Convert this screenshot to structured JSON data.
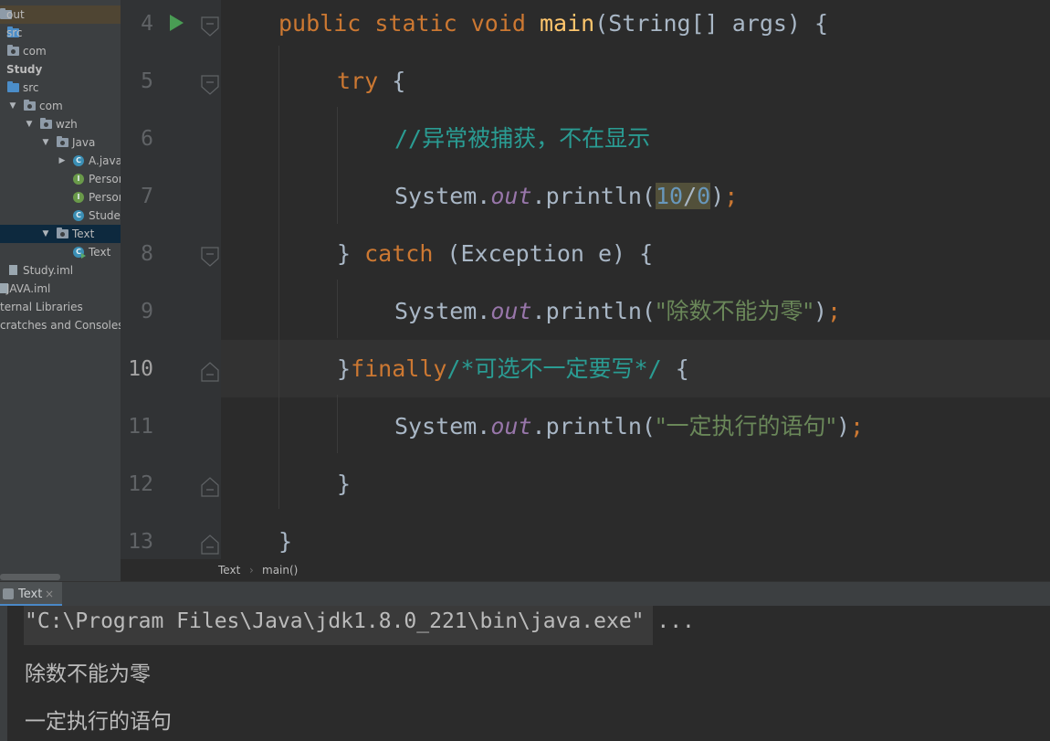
{
  "project_tree": {
    "items": [
      {
        "label": "out",
        "icon": "folder-icon",
        "kind": "folder-out",
        "arrow": "",
        "highlight": "orange"
      },
      {
        "label": "src",
        "icon": "source-folder-icon",
        "kind": "folder-src",
        "arrow": ""
      },
      {
        "label": "com",
        "icon": "package-icon",
        "kind": "package",
        "arrow": ""
      },
      {
        "label": "Study",
        "icon": "",
        "kind": "module",
        "arrow": "",
        "bold": true
      },
      {
        "label": "src",
        "icon": "source-folder-icon",
        "kind": "folder-src",
        "arrow": ""
      },
      {
        "label": "com",
        "icon": "package-icon",
        "kind": "package",
        "arrow": "expanded"
      },
      {
        "label": "wzh",
        "icon": "package-icon",
        "kind": "package",
        "arrow": "expanded"
      },
      {
        "label": "Java",
        "icon": "package-icon",
        "kind": "package",
        "arrow": "expanded"
      },
      {
        "label": "A.java",
        "icon": "class-icon",
        "kind": "class",
        "arrow": "collapsed"
      },
      {
        "label": "Person",
        "icon": "interface-icon",
        "kind": "interface",
        "arrow": ""
      },
      {
        "label": "Person",
        "icon": "interface-icon",
        "kind": "interface",
        "arrow": ""
      },
      {
        "label": "Studer",
        "icon": "class-icon",
        "kind": "class",
        "arrow": ""
      },
      {
        "label": "Text",
        "icon": "package-icon",
        "kind": "package",
        "arrow": "expanded",
        "highlight": "blue"
      },
      {
        "label": "Text",
        "icon": "runnable-class-icon",
        "kind": "runclass",
        "arrow": ""
      },
      {
        "label": "Study.iml",
        "icon": "iml-file-icon",
        "kind": "iml",
        "arrow": ""
      },
      {
        "label": "JAVA.iml",
        "icon": "iml-file-icon",
        "kind": "iml",
        "arrow": ""
      },
      {
        "label": "ternal Libraries",
        "icon": "",
        "kind": "plain",
        "arrow": ""
      },
      {
        "label": "cratches and Consoles",
        "icon": "",
        "kind": "plain",
        "arrow": ""
      }
    ]
  },
  "gutter": {
    "line_numbers": [
      "4",
      "5",
      "6",
      "7",
      "8",
      "9",
      "10",
      "11",
      "12",
      "13"
    ],
    "current_line": "10"
  },
  "code": {
    "l4": {
      "t1": "public static void ",
      "t2": "main",
      "t3": "(String[] args) {"
    },
    "l5": {
      "t1": "try",
      "t2": " {"
    },
    "l6": {
      "t1": "//",
      "t2": "异常被捕获，不在显示"
    },
    "l7": {
      "t1": "System.",
      "t2": "out",
      "t3": ".println(",
      "t4": "10",
      "t5": "/",
      "t6": "0",
      "t7": ")",
      "t8": ";"
    },
    "l8": {
      "t1": "} ",
      "t2": "catch",
      "t3": " (Exception e) {"
    },
    "l9": {
      "t1": "System.",
      "t2": "out",
      "t3": ".println(",
      "t4": "\"除数不能为零\"",
      "t5": ")",
      "t6": ";"
    },
    "l10": {
      "t1": "}",
      "t2": "finally",
      "t3": "/*",
      "t4": "可选不一定要写",
      "t5": "*/",
      "t6": " {"
    },
    "l11": {
      "t1": "System.",
      "t2": "out",
      "t3": ".println(",
      "t4": "\"一定执行的语句\"",
      "t5": ")",
      "t6": ";"
    },
    "l12": {
      "t1": "}"
    },
    "l13": {
      "t1": "}"
    }
  },
  "breadcrumb": {
    "class_name": "Text",
    "separator": "›",
    "method": "main()"
  },
  "run_panel": {
    "tab_label": "Text",
    "close_glyph": "×",
    "command": "\"C:\\Program Files\\Java\\jdk1.8.0_221\\bin\\java.exe\" ...",
    "output": [
      "除数不能为零",
      "一定执行的语句"
    ]
  }
}
